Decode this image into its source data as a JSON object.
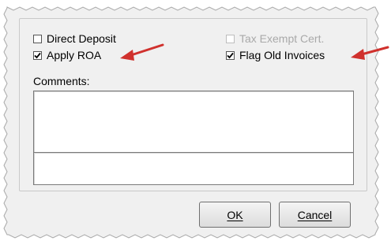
{
  "window": {
    "checkboxes": [
      {
        "label": "Direct Deposit",
        "checked": false,
        "enabled": true
      },
      {
        "label": "Apply ROA",
        "checked": true,
        "enabled": true
      },
      {
        "label": "Tax Exempt Cert.",
        "checked": false,
        "enabled": false
      },
      {
        "label": "Flag Old Invoices",
        "checked": true,
        "enabled": true
      }
    ],
    "comments_label": "Comments:",
    "buttons": {
      "ok": "OK",
      "cancel": "Cancel"
    }
  },
  "annotation": {
    "arrow_color": "#d0312d"
  }
}
